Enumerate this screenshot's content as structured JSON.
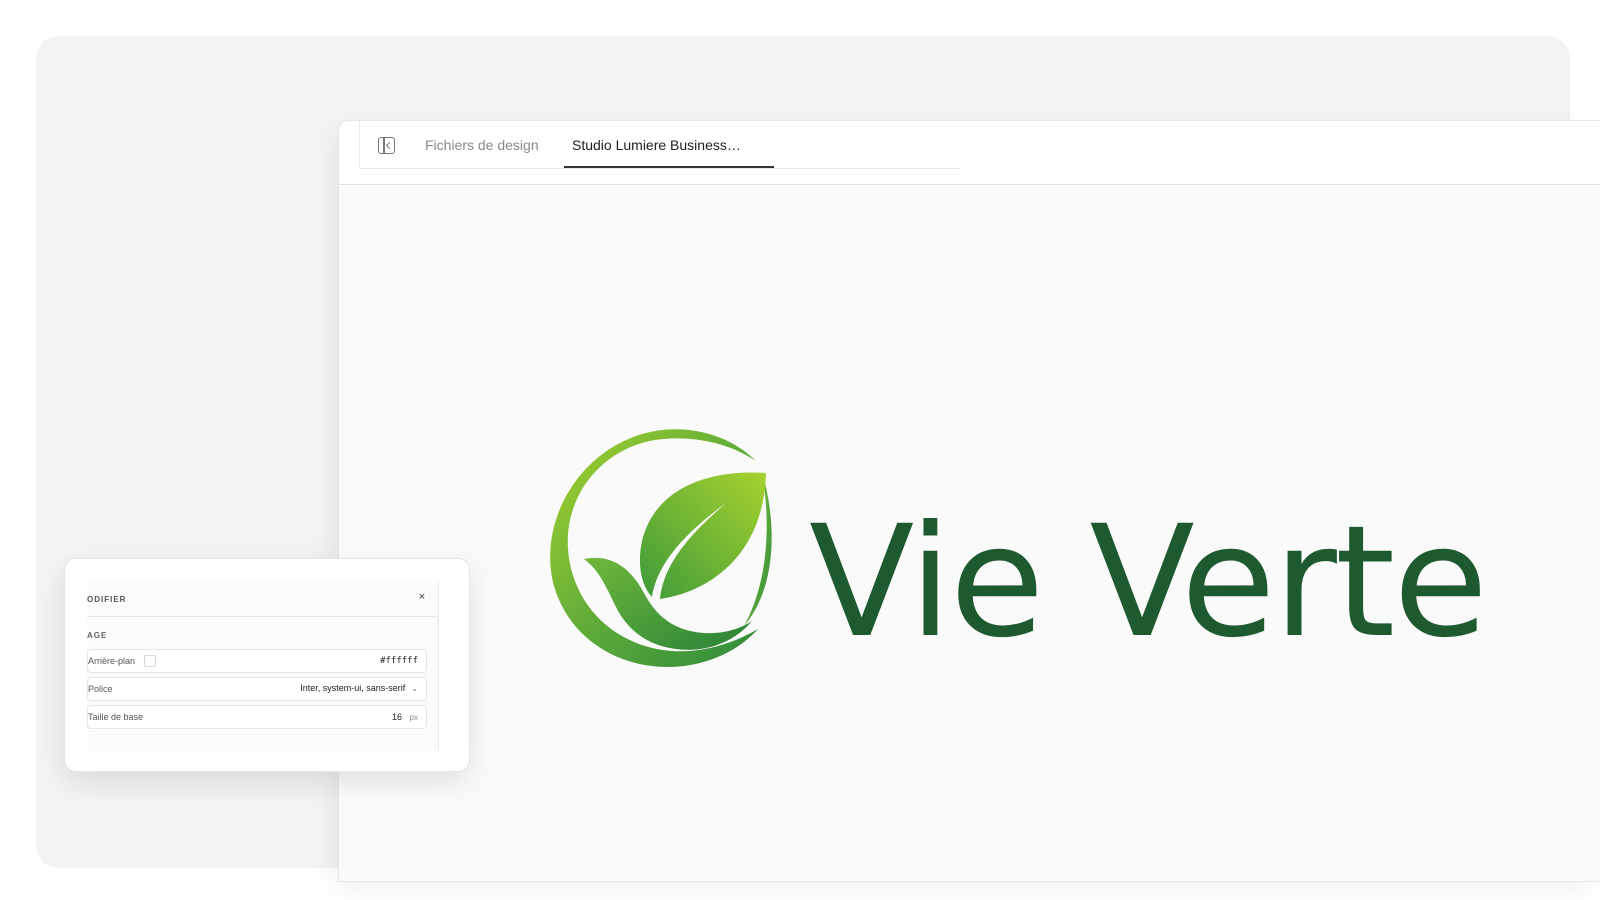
{
  "tabs": {
    "files_label": "Fichiers de design",
    "active_label": "Studio Lumiere Business…"
  },
  "icons": {
    "sidebar_toggle": "sidebar-toggle-icon",
    "close": "close-icon",
    "chevron": "chevron-down-icon"
  },
  "logo": {
    "text": "Vie Verte",
    "colors": {
      "text": "#1e5a30",
      "leaf_light": "#9acd32",
      "leaf_dark": "#2e8b3a"
    }
  },
  "panel": {
    "title": "ODIFIER",
    "close_glyph": "×",
    "section": "AGE",
    "background": {
      "label": "Arrière-plan",
      "value": "#ffffff"
    },
    "font": {
      "label": "Police",
      "value": "Inter, system-ui, sans-serif",
      "chevron": "⌄"
    },
    "base_size": {
      "label": "Taille de base",
      "value": "16",
      "unit": "px"
    }
  }
}
